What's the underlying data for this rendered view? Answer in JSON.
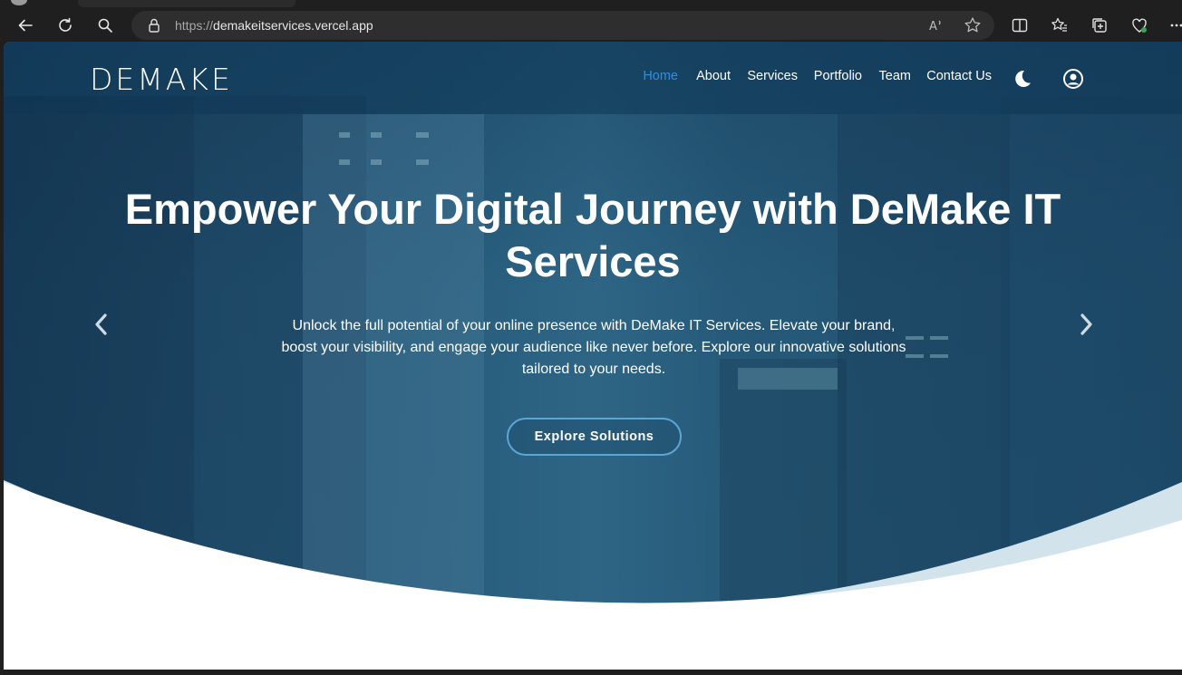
{
  "browser": {
    "url_protocol": "https://",
    "url_host": "demakeitservices.vercel.app",
    "icons": [
      "back-icon",
      "refresh-icon",
      "search-icon",
      "lock-icon",
      "read-aloud-icon",
      "favorite-star-icon",
      "split-screen-icon",
      "favorites-icon",
      "collections-icon",
      "browser-essentials-icon",
      "more-icon"
    ]
  },
  "site": {
    "logo": "DEMAKE",
    "nav": {
      "home": "Home",
      "about": "About",
      "services": "Services",
      "portfolio": "Portfolio",
      "team": "Team",
      "contact": "Contact Us"
    },
    "hero": {
      "title": "Empower Your Digital Journey with DeMake IT Services",
      "subtitle": "Unlock the full potential of your online presence with DeMake IT Services. Elevate your brand, boost your visibility, and engage your audience like never before. Explore our innovative solutions tailored to your needs.",
      "cta": "Explore Solutions"
    },
    "colors": {
      "nav_active": "#2f8ee5",
      "cta_border": "#5aa7d6",
      "wave_light": "#d3e3ec"
    }
  }
}
